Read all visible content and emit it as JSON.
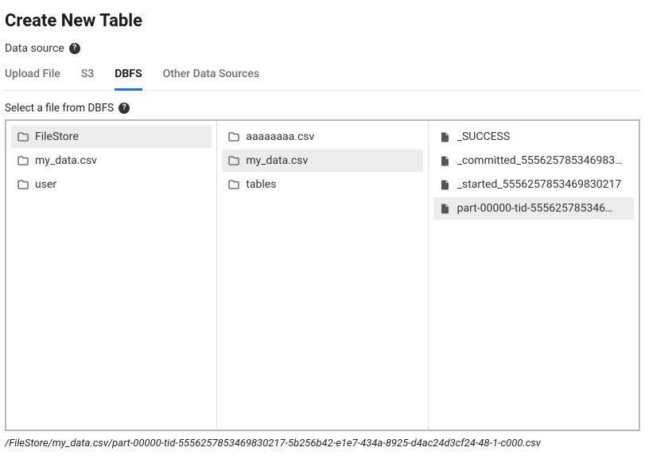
{
  "page": {
    "title": "Create New Table",
    "data_source_label": "Data source",
    "select_file_label": "Select a file from DBFS"
  },
  "tabs": [
    {
      "label": "Upload File",
      "active": false
    },
    {
      "label": "S3",
      "active": false
    },
    {
      "label": "DBFS",
      "active": true
    },
    {
      "label": "Other Data Sources",
      "active": false
    }
  ],
  "browser": {
    "columns": [
      {
        "items": [
          {
            "type": "folder",
            "name": "FileStore",
            "selected": true
          },
          {
            "type": "folder",
            "name": "my_data.csv",
            "selected": false
          },
          {
            "type": "folder",
            "name": "user",
            "selected": false
          }
        ]
      },
      {
        "items": [
          {
            "type": "folder",
            "name": "aaaaaaaa.csv",
            "selected": false
          },
          {
            "type": "folder",
            "name": "my_data.csv",
            "selected": true
          },
          {
            "type": "folder",
            "name": "tables",
            "selected": false
          }
        ]
      },
      {
        "items": [
          {
            "type": "file",
            "name": "_SUCCESS",
            "selected": false
          },
          {
            "type": "file",
            "name": "_committed_555625785346983…",
            "selected": false
          },
          {
            "type": "file",
            "name": "_started_5556257853469830217",
            "selected": false
          },
          {
            "type": "file",
            "name": "part-00000-tid-555625785346…",
            "selected": true
          }
        ]
      }
    ]
  },
  "selected_path": "/FileStore/my_data.csv/part-00000-tid-5556257853469830217-5b256b42-e1e7-434a-8925-d4ac24d3cf24-48-1-c000.csv"
}
